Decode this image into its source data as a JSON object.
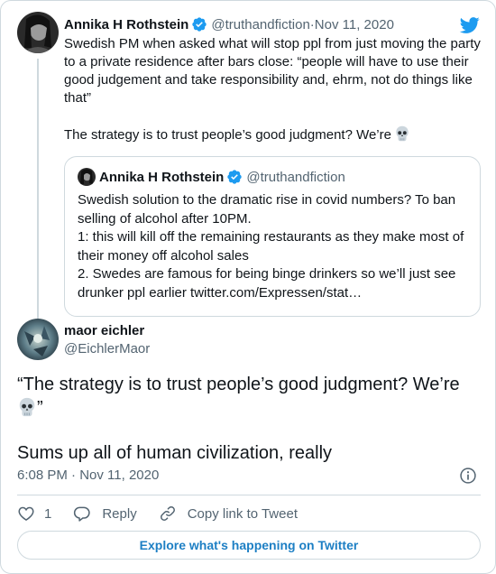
{
  "parent_tweet": {
    "author_name": "Annika H Rothstein",
    "handle": "@truthandfiction",
    "separator": " · ",
    "date": "Nov 11, 2020",
    "text_line1": "Swedish PM when asked what will stop ppl from just moving the party to a private residence after bars close: “people will have to use their good judgement and take responsibility and, ehrm, not do things like that”",
    "text_line2": "The strategy is to trust people’s good judgment? We’re",
    "quoted_tweet": {
      "author_name": "Annika H Rothstein",
      "handle": "@truthandfiction",
      "lines": [
        "Swedish solution to the dramatic rise in covid numbers? To ban selling of alcohol after 10PM.",
        "1: this will kill off the remaining restaurants as they make most of their money off alcohol sales",
        "2. Swedes are famous for being binge drinkers so we’ll just see drunker ppl earlier twitter.com/Expressen/stat…"
      ]
    }
  },
  "main_tweet": {
    "author_name": "maor eichler",
    "handle": "@EichlerMaor",
    "text_line1": "“The strategy is to trust people’s good judgment? We’re",
    "text_line1_end": "”",
    "text_line2": "Sums up all of human civilization, really",
    "time": "6:08 PM · Nov 11, 2020"
  },
  "actions": {
    "like_count": "1",
    "reply_label": "Reply",
    "copy_link_label": "Copy link to Tweet"
  },
  "footer": {
    "explore_label": "Explore what's happening on Twitter"
  },
  "icons": {
    "verified": "verified-badge-icon",
    "twitter": "twitter-bird-icon",
    "skull": "skull-icon",
    "info": "info-icon",
    "heart": "heart-icon",
    "reply": "reply-bubble-icon",
    "link": "link-icon"
  },
  "colors": {
    "twitter_blue": "#1d9bf0",
    "link_blue": "#1d7fc4",
    "secondary_text": "#536471",
    "border": "#cfd9de"
  }
}
